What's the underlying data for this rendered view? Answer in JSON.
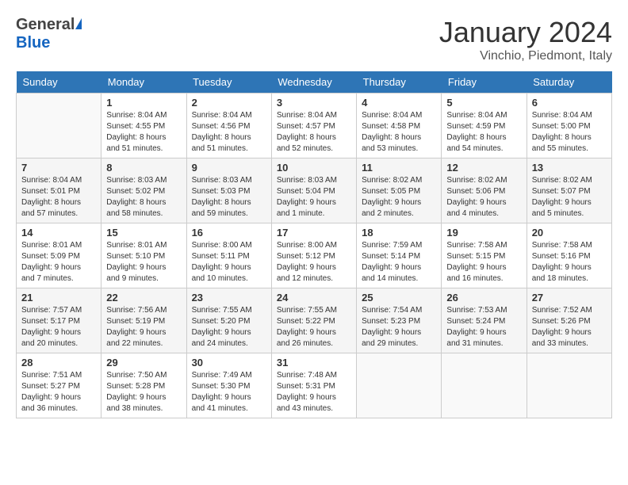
{
  "header": {
    "logo_general": "General",
    "logo_blue": "Blue",
    "title": "January 2024",
    "subtitle": "Vinchio, Piedmont, Italy"
  },
  "days": [
    "Sunday",
    "Monday",
    "Tuesday",
    "Wednesday",
    "Thursday",
    "Friday",
    "Saturday"
  ],
  "weeks": [
    [
      {
        "date": "",
        "info": ""
      },
      {
        "date": "1",
        "info": "Sunrise: 8:04 AM\nSunset: 4:55 PM\nDaylight: 8 hours\nand 51 minutes."
      },
      {
        "date": "2",
        "info": "Sunrise: 8:04 AM\nSunset: 4:56 PM\nDaylight: 8 hours\nand 51 minutes."
      },
      {
        "date": "3",
        "info": "Sunrise: 8:04 AM\nSunset: 4:57 PM\nDaylight: 8 hours\nand 52 minutes."
      },
      {
        "date": "4",
        "info": "Sunrise: 8:04 AM\nSunset: 4:58 PM\nDaylight: 8 hours\nand 53 minutes."
      },
      {
        "date": "5",
        "info": "Sunrise: 8:04 AM\nSunset: 4:59 PM\nDaylight: 8 hours\nand 54 minutes."
      },
      {
        "date": "6",
        "info": "Sunrise: 8:04 AM\nSunset: 5:00 PM\nDaylight: 8 hours\nand 55 minutes."
      }
    ],
    [
      {
        "date": "7",
        "info": "Sunrise: 8:04 AM\nSunset: 5:01 PM\nDaylight: 8 hours\nand 57 minutes."
      },
      {
        "date": "8",
        "info": "Sunrise: 8:03 AM\nSunset: 5:02 PM\nDaylight: 8 hours\nand 58 minutes."
      },
      {
        "date": "9",
        "info": "Sunrise: 8:03 AM\nSunset: 5:03 PM\nDaylight: 8 hours\nand 59 minutes."
      },
      {
        "date": "10",
        "info": "Sunrise: 8:03 AM\nSunset: 5:04 PM\nDaylight: 9 hours\nand 1 minute."
      },
      {
        "date": "11",
        "info": "Sunrise: 8:02 AM\nSunset: 5:05 PM\nDaylight: 9 hours\nand 2 minutes."
      },
      {
        "date": "12",
        "info": "Sunrise: 8:02 AM\nSunset: 5:06 PM\nDaylight: 9 hours\nand 4 minutes."
      },
      {
        "date": "13",
        "info": "Sunrise: 8:02 AM\nSunset: 5:07 PM\nDaylight: 9 hours\nand 5 minutes."
      }
    ],
    [
      {
        "date": "14",
        "info": "Sunrise: 8:01 AM\nSunset: 5:09 PM\nDaylight: 9 hours\nand 7 minutes."
      },
      {
        "date": "15",
        "info": "Sunrise: 8:01 AM\nSunset: 5:10 PM\nDaylight: 9 hours\nand 9 minutes."
      },
      {
        "date": "16",
        "info": "Sunrise: 8:00 AM\nSunset: 5:11 PM\nDaylight: 9 hours\nand 10 minutes."
      },
      {
        "date": "17",
        "info": "Sunrise: 8:00 AM\nSunset: 5:12 PM\nDaylight: 9 hours\nand 12 minutes."
      },
      {
        "date": "18",
        "info": "Sunrise: 7:59 AM\nSunset: 5:14 PM\nDaylight: 9 hours\nand 14 minutes."
      },
      {
        "date": "19",
        "info": "Sunrise: 7:58 AM\nSunset: 5:15 PM\nDaylight: 9 hours\nand 16 minutes."
      },
      {
        "date": "20",
        "info": "Sunrise: 7:58 AM\nSunset: 5:16 PM\nDaylight: 9 hours\nand 18 minutes."
      }
    ],
    [
      {
        "date": "21",
        "info": "Sunrise: 7:57 AM\nSunset: 5:17 PM\nDaylight: 9 hours\nand 20 minutes."
      },
      {
        "date": "22",
        "info": "Sunrise: 7:56 AM\nSunset: 5:19 PM\nDaylight: 9 hours\nand 22 minutes."
      },
      {
        "date": "23",
        "info": "Sunrise: 7:55 AM\nSunset: 5:20 PM\nDaylight: 9 hours\nand 24 minutes."
      },
      {
        "date": "24",
        "info": "Sunrise: 7:55 AM\nSunset: 5:22 PM\nDaylight: 9 hours\nand 26 minutes."
      },
      {
        "date": "25",
        "info": "Sunrise: 7:54 AM\nSunset: 5:23 PM\nDaylight: 9 hours\nand 29 minutes."
      },
      {
        "date": "26",
        "info": "Sunrise: 7:53 AM\nSunset: 5:24 PM\nDaylight: 9 hours\nand 31 minutes."
      },
      {
        "date": "27",
        "info": "Sunrise: 7:52 AM\nSunset: 5:26 PM\nDaylight: 9 hours\nand 33 minutes."
      }
    ],
    [
      {
        "date": "28",
        "info": "Sunrise: 7:51 AM\nSunset: 5:27 PM\nDaylight: 9 hours\nand 36 minutes."
      },
      {
        "date": "29",
        "info": "Sunrise: 7:50 AM\nSunset: 5:28 PM\nDaylight: 9 hours\nand 38 minutes."
      },
      {
        "date": "30",
        "info": "Sunrise: 7:49 AM\nSunset: 5:30 PM\nDaylight: 9 hours\nand 41 minutes."
      },
      {
        "date": "31",
        "info": "Sunrise: 7:48 AM\nSunset: 5:31 PM\nDaylight: 9 hours\nand 43 minutes."
      },
      {
        "date": "",
        "info": ""
      },
      {
        "date": "",
        "info": ""
      },
      {
        "date": "",
        "info": ""
      }
    ]
  ]
}
